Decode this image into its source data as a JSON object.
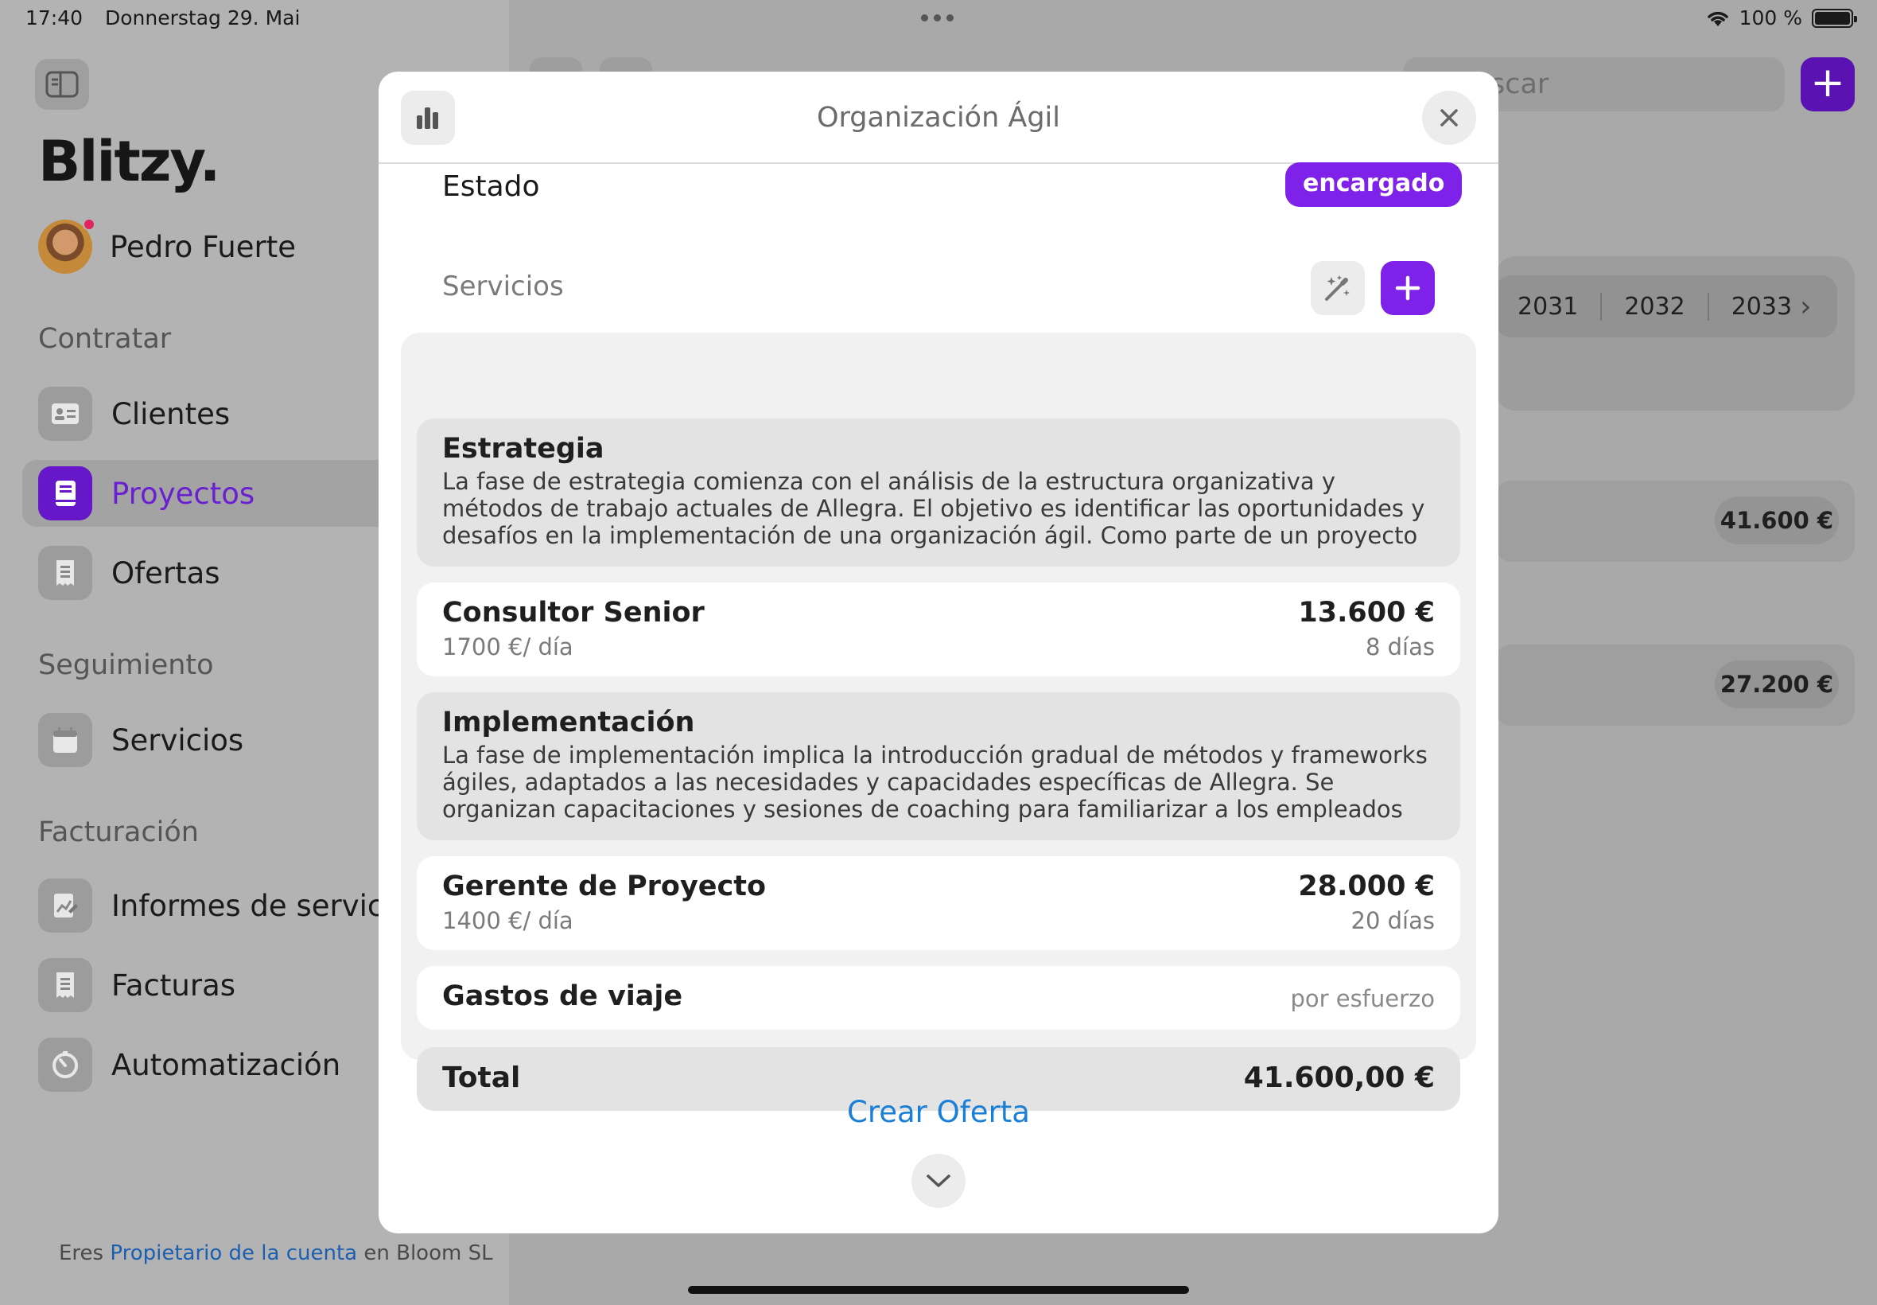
{
  "status_bar": {
    "time": "17:40",
    "date": "Donnerstag 29. Mai",
    "battery": "100 %",
    "battery_level": 1.0
  },
  "sidebar": {
    "brand": "Blitzy.",
    "user_name": "Pedro Fuerte",
    "sections": [
      {
        "title": "Contratar",
        "items": [
          {
            "label": "Clientes",
            "icon": "contact-card-icon",
            "active": false
          },
          {
            "label": "Proyectos",
            "icon": "book-icon",
            "active": true
          },
          {
            "label": "Ofertas",
            "icon": "receipt-icon",
            "active": false
          }
        ]
      },
      {
        "title": "Seguimiento",
        "items": [
          {
            "label": "Servicios",
            "icon": "calendar-icon",
            "active": false
          }
        ]
      },
      {
        "title": "Facturación",
        "items": [
          {
            "label": "Informes de servicio",
            "icon": "chart-report-icon",
            "active": false
          },
          {
            "label": "Facturas",
            "icon": "receipt-icon",
            "active": false
          },
          {
            "label": "Automatización",
            "icon": "timer-icon",
            "active": false
          }
        ]
      }
    ],
    "footer": {
      "prefix": "Eres",
      "role_link": "Propietario de la cuenta",
      "suffix": "en Bloom SL"
    }
  },
  "background": {
    "search_placeholder_visible": "scar",
    "years": [
      "2031",
      "2032",
      "2033"
    ],
    "amounts": [
      "41.600 €",
      "27.200 €"
    ]
  },
  "modal": {
    "title": "Organización Ágil",
    "estado_label": "Estado",
    "estado_value": "encargado",
    "services_label": "Servicios",
    "phases": [
      {
        "title": "Estrategia",
        "description": "La fase de estrategia comienza con el análisis de la estructura organizativa y métodos de trabajo actuales de Allegra. El objetivo es identificar las oportunidades y desafíos en la implementación de una organización ágil. Como parte de un proyecto de New Work mode…"
      },
      {
        "title": "Implementación",
        "description": "La fase de implementación implica la introducción gradual de métodos y frameworks ágiles, adaptados a las necesidades y capacidades específicas de Allegra. Se organizan capacitaciones y sesiones de coaching para familiarizar a los empleados con las nuevas for…"
      }
    ],
    "items": [
      {
        "name": "Consultor Senior",
        "rate": "1700 €/ día",
        "price": "13.600 €",
        "days": "8 días"
      },
      {
        "name": "Gerente de Proyecto",
        "rate": "1400 €/ día",
        "price": "28.000 €",
        "days": "20 días"
      }
    ],
    "travel": {
      "name": "Gastos de viaje",
      "note": "por esfuerzo"
    },
    "total": {
      "label": "Total",
      "value": "41.600,00 €"
    },
    "create_offer": "Crear Oferta"
  },
  "colors": {
    "accent": "#7e22ea",
    "link": "#1a7fd6"
  }
}
